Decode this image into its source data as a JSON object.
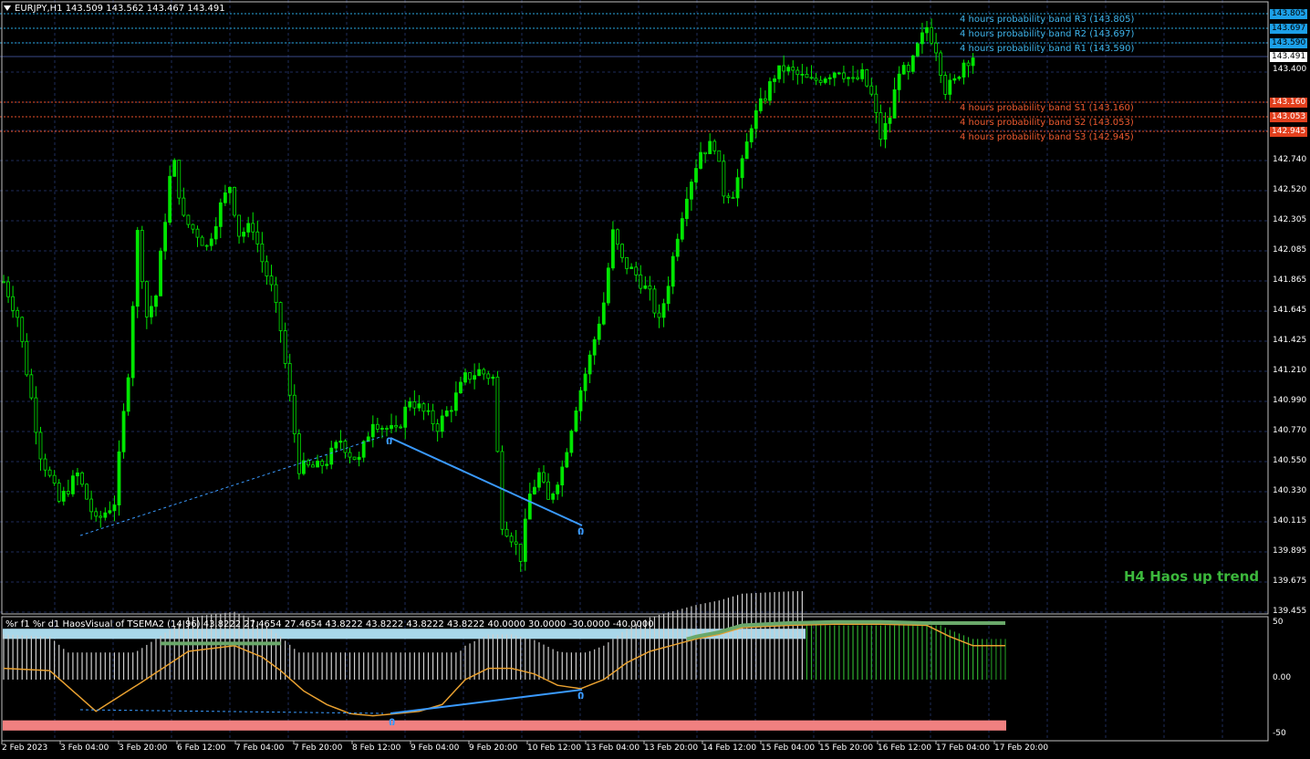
{
  "header": {
    "symbol_line": "EURJPY,H1  143.509 143.562 143.467 143.491"
  },
  "indicator_header": {
    "text": "%r f1 %r d1 HaosVisual of TSEMA2 (14 96) 43.8222 27.4654 27.4654 43.8222 43.8222 43.8222 43.8222 40.0000 30.0000 -30.0000 -40.0000"
  },
  "trend_label": "H4 Haos up trend",
  "colors": {
    "background": "#000000",
    "grid": "#1e2b5a",
    "candle": "#00e600",
    "resistance": "#29a8e0",
    "support": "#e8502a",
    "trendline": "#3a9aff",
    "orange_line": "#e8a030",
    "hist_up": "#2fae2f",
    "hist_light": "#cfcfcf",
    "band_top": "#a9d8ea",
    "band_bottom": "#f08080"
  },
  "bands": [
    {
      "label": "4 hours probability band R3 (143.805)",
      "price": 143.805,
      "tag": "143.805",
      "kind": "resistance"
    },
    {
      "label": "4 hours probability band R2 (143.697)",
      "price": 143.697,
      "tag": "143.697",
      "kind": "resistance"
    },
    {
      "label": "4 hours probability band R1 (143.590)",
      "price": 143.59,
      "tag": "143.590",
      "kind": "resistance"
    },
    {
      "label": "4 hours probability band S1 (143.160)",
      "price": 143.16,
      "tag": "143.160",
      "kind": "support"
    },
    {
      "label": "4 hours probability band S2 (143.053)",
      "price": 143.053,
      "tag": "143.053",
      "kind": "support"
    },
    {
      "label": "4 hours probability band S3 (142.945)",
      "price": 142.945,
      "tag": "142.945",
      "kind": "support"
    }
  ],
  "current_price": {
    "price": 143.491,
    "tag": "143.491"
  },
  "price_axis": [
    "143.400",
    "142.740",
    "142.520",
    "142.305",
    "142.085",
    "141.865",
    "141.645",
    "141.425",
    "141.210",
    "140.990",
    "140.770",
    "140.550",
    "140.330",
    "140.115",
    "139.895",
    "139.675",
    "139.455"
  ],
  "indicator_axis": [
    "50",
    "0.00",
    "-50"
  ],
  "time_axis": [
    "2 Feb 2023",
    "3 Feb 04:00",
    "3 Feb 20:00",
    "6 Feb 12:00",
    "7 Feb 04:00",
    "7 Feb 20:00",
    "8 Feb 12:00",
    "9 Feb 04:00",
    "9 Feb 20:00",
    "10 Feb 12:00",
    "13 Feb 04:00",
    "13 Feb 20:00",
    "14 Feb 12:00",
    "15 Feb 04:00",
    "15 Feb 20:00",
    "16 Feb 12:00",
    "17 Feb 04:00",
    "17 Feb 20:00"
  ],
  "chart_data": {
    "type": "line",
    "symbol": "EURJPY",
    "timeframe": "H1",
    "ohlc_last": {
      "open": 143.509,
      "high": 143.562,
      "low": 143.467,
      "close": 143.491
    },
    "ylim": [
      139.455,
      143.805
    ],
    "price_path": [
      [
        0,
        141.85
      ],
      [
        3,
        141.6
      ],
      [
        8,
        140.6
      ],
      [
        12,
        140.25
      ],
      [
        16,
        140.45
      ],
      [
        20,
        140.1
      ],
      [
        24,
        140.25
      ],
      [
        27,
        141.2
      ],
      [
        29,
        142.2
      ],
      [
        31,
        141.6
      ],
      [
        33,
        141.75
      ],
      [
        36,
        142.6
      ],
      [
        37,
        142.7
      ],
      [
        39,
        142.3
      ],
      [
        42,
        142.2
      ],
      [
        44,
        142.1
      ],
      [
        47,
        142.4
      ],
      [
        49,
        142.55
      ],
      [
        51,
        142.2
      ],
      [
        54,
        142.25
      ],
      [
        56,
        142.0
      ],
      [
        58,
        141.8
      ],
      [
        60,
        141.5
      ],
      [
        62,
        141.0
      ],
      [
        64,
        140.5
      ],
      [
        66,
        140.5
      ],
      [
        68,
        140.5
      ],
      [
        70,
        140.55
      ],
      [
        73,
        140.7
      ],
      [
        75,
        140.6
      ],
      [
        77,
        140.55
      ],
      [
        80,
        140.85
      ],
      [
        82,
        140.8
      ],
      [
        85,
        140.75
      ],
      [
        88,
        141.0
      ],
      [
        91,
        140.9
      ],
      [
        94,
        140.8
      ],
      [
        97,
        140.95
      ],
      [
        100,
        141.15
      ],
      [
        103,
        141.2
      ],
      [
        106,
        141.15
      ],
      [
        107,
        140.6
      ],
      [
        108,
        140.1
      ],
      [
        110,
        140.0
      ],
      [
        112,
        139.85
      ],
      [
        114,
        140.3
      ],
      [
        116,
        140.45
      ],
      [
        118,
        140.25
      ],
      [
        121,
        140.5
      ],
      [
        124,
        140.95
      ],
      [
        127,
        141.3
      ],
      [
        130,
        141.7
      ],
      [
        132,
        142.2
      ],
      [
        134,
        142.0
      ],
      [
        137,
        141.9
      ],
      [
        140,
        141.75
      ],
      [
        142,
        141.55
      ],
      [
        144,
        141.85
      ],
      [
        146,
        142.2
      ],
      [
        148,
        142.5
      ],
      [
        151,
        142.8
      ],
      [
        154,
        142.85
      ],
      [
        156,
        142.5
      ],
      [
        158,
        142.5
      ],
      [
        160,
        142.7
      ],
      [
        162,
        143.0
      ],
      [
        165,
        143.2
      ],
      [
        167,
        143.35
      ],
      [
        169,
        143.4
      ],
      [
        172,
        143.35
      ],
      [
        175,
        143.3
      ],
      [
        178,
        143.35
      ],
      [
        181,
        143.4
      ],
      [
        184,
        143.3
      ],
      [
        186,
        143.35
      ],
      [
        188,
        143.2
      ],
      [
        190,
        142.9
      ],
      [
        192,
        143.05
      ],
      [
        194,
        143.4
      ],
      [
        196,
        143.35
      ],
      [
        198,
        143.55
      ],
      [
        200,
        143.7
      ],
      [
        202,
        143.55
      ],
      [
        204,
        143.25
      ],
      [
        206,
        143.3
      ],
      [
        208,
        143.45
      ],
      [
        210,
        143.491
      ]
    ],
    "indicator": {
      "ylim": [
        -50,
        50
      ],
      "levels": [
        40,
        30,
        -30,
        -40
      ],
      "orange": [
        [
          0,
          10
        ],
        [
          10,
          8
        ],
        [
          20,
          -28
        ],
        [
          30,
          -2
        ],
        [
          40,
          25
        ],
        [
          50,
          30
        ],
        [
          56,
          20
        ],
        [
          60,
          8
        ],
        [
          65,
          -10
        ],
        [
          70,
          -22
        ],
        [
          75,
          -30
        ],
        [
          80,
          -32
        ],
        [
          85,
          -30
        ],
        [
          90,
          -28
        ],
        [
          95,
          -22
        ],
        [
          100,
          0
        ],
        [
          105,
          10
        ],
        [
          110,
          10
        ],
        [
          115,
          5
        ],
        [
          120,
          -5
        ],
        [
          125,
          -8
        ],
        [
          130,
          0
        ],
        [
          135,
          15
        ],
        [
          140,
          25
        ],
        [
          150,
          36
        ],
        [
          155,
          40
        ],
        [
          160,
          46
        ],
        [
          170,
          48
        ],
        [
          180,
          49
        ],
        [
          190,
          49
        ],
        [
          200,
          48
        ],
        [
          205,
          38
        ],
        [
          210,
          30
        ]
      ]
    }
  }
}
